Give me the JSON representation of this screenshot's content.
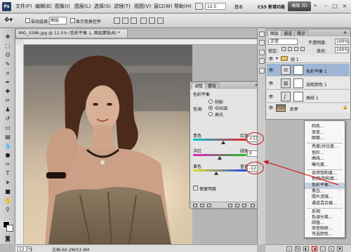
{
  "app": {
    "logo": "Ps"
  },
  "menubar": {
    "items": [
      "文件(F)",
      "编辑(E)",
      "图像(I)",
      "图层(L)",
      "选择(S)",
      "滤镜(T)",
      "视图(V)",
      "窗口(W)",
      "帮助(H)"
    ],
    "zoom": "12.5",
    "workspaces": {
      "basic": "基本",
      "new_features": "CS5 新增功能",
      "design_3d": "高级 3D",
      "more": "»"
    },
    "window_buttons": [
      "–",
      "□",
      "×"
    ]
  },
  "optbar": {
    "auto_select_label": "自动选择:",
    "auto_select_value": "图层",
    "show_transform_label": "显示变换控件"
  },
  "document": {
    "tab_title": "IMG_0586.jpg @ 12.5% (色彩平衡 1, 图层蒙版/8) *",
    "zoom_status": "12.5%",
    "doc_size": "文档:60.2M/53.9M"
  },
  "adjustments": {
    "tabs": [
      "调整",
      "蒙版"
    ],
    "title": "色彩平衡",
    "tone_label": "色调:",
    "tones": [
      "阴影",
      "中间调",
      "高光"
    ],
    "selected_tone": "中间调",
    "sliders": [
      {
        "left": "青色",
        "right": "红色",
        "value": "+13",
        "level": 0.565
      },
      {
        "left": "洋红",
        "right": "绿色",
        "value": "0",
        "level": 0.5
      },
      {
        "left": "黄色",
        "right": "蓝色",
        "value": "-12",
        "level": 0.44
      }
    ],
    "preserve_luminosity": "保留明度"
  },
  "layers": {
    "tabs": [
      "图层",
      "通道",
      "路径"
    ],
    "blend_mode": "正常",
    "opacity_label": "不透明度:",
    "opacity": "100%",
    "lock_label": "锁定:",
    "fill_label": "填充:",
    "fill": "100%",
    "rows": [
      {
        "name": "组 1",
        "kind": "group"
      },
      {
        "name": "色彩平衡 1",
        "kind": "adjustment"
      },
      {
        "name": "选取颜色 1",
        "kind": "adjustment"
      },
      {
        "name": "曲线 1",
        "kind": "adjustment"
      },
      {
        "name": "背景",
        "kind": "background"
      }
    ]
  },
  "context_menu": {
    "groups": [
      [
        "纯色...",
        "渐变...",
        "图案..."
      ],
      [
        "亮度/对比度...",
        "色阶...",
        "曲线...",
        "曝光度..."
      ],
      [
        "自然饱和度...",
        "色相/饱和度...",
        "色彩平衡...",
        "黑白...",
        "照片滤镜...",
        "通道混合器..."
      ],
      [
        "反相",
        "色调分离...",
        "阈值...",
        "渐变映射...",
        "可选颜色..."
      ]
    ],
    "highlighted": "色彩平衡..."
  },
  "colors": {
    "accent_red": "#d21a1a",
    "selection_blue": "#9fb7d6",
    "ps_blue": "#2a3d6a"
  }
}
